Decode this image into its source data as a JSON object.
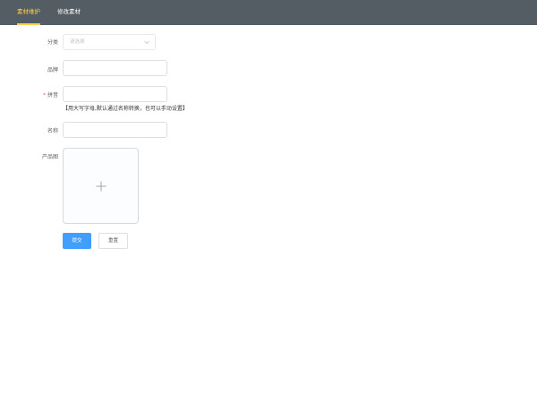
{
  "nav": {
    "tabs": [
      {
        "label": "素材维护",
        "active": true
      },
      {
        "label": "修改素材",
        "active": false
      }
    ],
    "background": "#545c64",
    "active_color": "#ffd04b"
  },
  "form": {
    "category": {
      "label": "分类",
      "placeholder": "请选择"
    },
    "brand": {
      "label": "品牌",
      "value": ""
    },
    "pinyin": {
      "required_mark": "*",
      "label": "拼音",
      "value": "",
      "hint": "【用大写字母,默认通过名称转换，也可以手动设置】"
    },
    "name": {
      "label": "名称",
      "value": ""
    },
    "image": {
      "label": "产品图",
      "icon": "plus-icon"
    }
  },
  "actions": {
    "submit_label": "提交",
    "reset_label": "重置",
    "primary_color": "#409eff"
  }
}
